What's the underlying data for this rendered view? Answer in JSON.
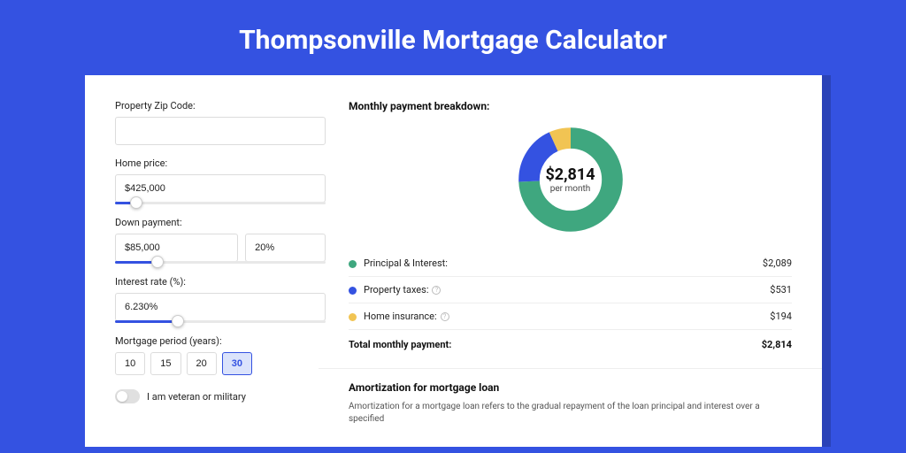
{
  "title": "Thompsonville Mortgage Calculator",
  "form": {
    "zip": {
      "label": "Property Zip Code:",
      "value": ""
    },
    "homePrice": {
      "label": "Home price:",
      "value": "$425,000",
      "sliderPct": 10
    },
    "downPayment": {
      "label": "Down payment:",
      "amount": "$85,000",
      "percent": "20%",
      "sliderPct": 20
    },
    "interestRate": {
      "label": "Interest rate (%):",
      "value": "6.230%",
      "sliderPct": 30
    },
    "period": {
      "label": "Mortgage period (years):",
      "options": [
        "10",
        "15",
        "20",
        "30"
      ],
      "active": "30"
    },
    "veteran": {
      "label": "I am veteran or military",
      "on": false
    }
  },
  "breakdown": {
    "title": "Monthly payment breakdown:",
    "centerAmount": "$2,814",
    "centerSub": "per month",
    "items": [
      {
        "color": "green",
        "label": "Principal & Interest:",
        "value": "$2,089",
        "info": false
      },
      {
        "color": "blue",
        "label": "Property taxes:",
        "value": "$531",
        "info": true
      },
      {
        "color": "yellow",
        "label": "Home insurance:",
        "value": "$194",
        "info": true
      }
    ],
    "totalLabel": "Total monthly payment:",
    "totalValue": "$2,814"
  },
  "chart_data": {
    "type": "pie",
    "title": "Monthly payment breakdown",
    "series": [
      {
        "name": "Principal & Interest",
        "value": 2089,
        "color": "#3fa77f"
      },
      {
        "name": "Property taxes",
        "value": 531,
        "color": "#3452e1"
      },
      {
        "name": "Home insurance",
        "value": 194,
        "color": "#f1c453"
      }
    ],
    "total": 2814,
    "center_label": "$2,814 per month"
  },
  "amortization": {
    "title": "Amortization for mortgage loan",
    "text": "Amortization for a mortgage loan refers to the gradual repayment of the loan principal and interest over a specified"
  }
}
